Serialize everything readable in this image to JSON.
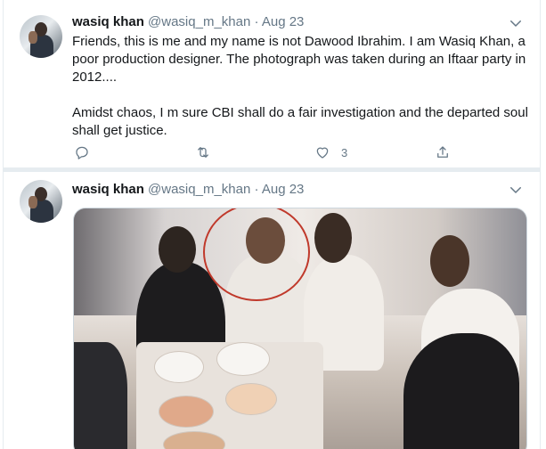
{
  "tweets": [
    {
      "name": "wasiq khan",
      "handle": "@wasiq_m_khan",
      "separator": "·",
      "date": "Aug 23",
      "text_paragraphs": [
        "Friends, this is me and my name is not Dawood Ibrahim. I am Wasiq Khan, a poor production designer.  The photograph was taken during an Iftaar party in 2012....",
        "Amidst chaos, I m sure CBI shall do a fair investigation and the departed soul shall get justice."
      ],
      "reply_count": "",
      "retweet_count": "",
      "like_count": "3"
    },
    {
      "name": "wasiq khan",
      "handle": "@wasiq_m_khan",
      "separator": "·",
      "date": "Aug 23"
    }
  ],
  "icons": {
    "caret": "chevron-down-icon",
    "reply": "reply-icon",
    "retweet": "retweet-icon",
    "like": "heart-icon",
    "share": "share-icon"
  },
  "colors": {
    "text": "#14171a",
    "secondary": "#657786",
    "border": "#e6ecf0",
    "annotation_circle": "#c0392b"
  }
}
